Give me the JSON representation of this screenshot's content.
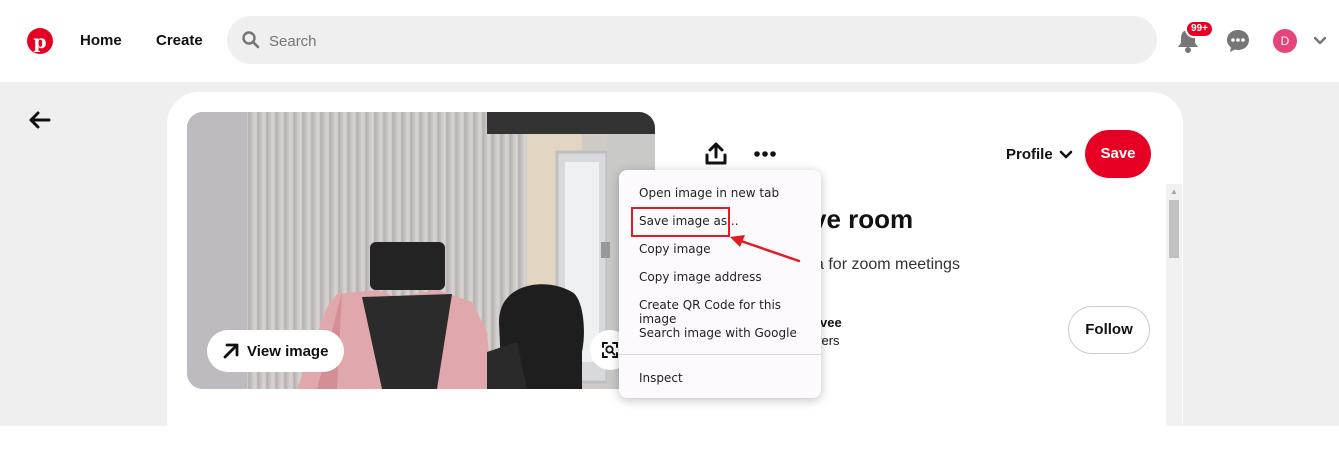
{
  "header": {
    "nav": [
      "Home",
      "Create"
    ],
    "search_placeholder": "Search",
    "notifications_badge": "99+",
    "avatar_initial": "D"
  },
  "pin": {
    "view_image_label": "View image",
    "profile_label": "Profile",
    "save_label": "Save",
    "title_visible": "ve room",
    "description_visible": "a for zoom meetings",
    "username_visible": "rvee",
    "followers_visible": "vers",
    "follow_label": "Follow"
  },
  "context_menu": {
    "items": [
      "Open image in new tab",
      "Save image as...",
      "Copy image",
      "Copy image address",
      "Create QR Code for this image",
      "Search image with Google",
      "Inspect"
    ],
    "highlighted_index": 1
  },
  "colors": {
    "brand": "#e60023",
    "annotation": "#e31b23"
  }
}
